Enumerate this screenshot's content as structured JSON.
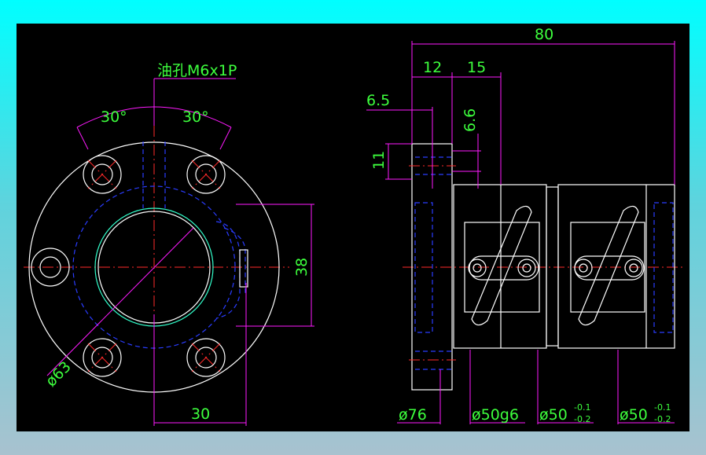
{
  "drawing": {
    "oil_hole_note": "油孔M6x1P",
    "front_view": {
      "angle_left": "30°",
      "angle_right": "30°",
      "dim_38": "38",
      "dim_30": "30",
      "dim_phi63": "ø63"
    },
    "side_view": {
      "dim_80": "80",
      "dim_12": "12",
      "dim_15": "15",
      "dim_6_5": "6.5",
      "dim_6_6": "6.6",
      "dim_11": "11",
      "dim_phi76": "ø76",
      "dim_phi50g6": "ø50g6",
      "tol_a": {
        "base": "ø50",
        "upper": "-0.1",
        "lower": "-0.2"
      },
      "tol_b": {
        "base": "ø50",
        "upper": "-0.1",
        "lower": "-0.2"
      }
    },
    "colors": {
      "background": "#000000",
      "outline": "#ffffff",
      "hidden": "#2a3cff",
      "centerline": "#ff2a2a",
      "dimension": "#ff1aff",
      "text": "#3dff3d"
    }
  }
}
